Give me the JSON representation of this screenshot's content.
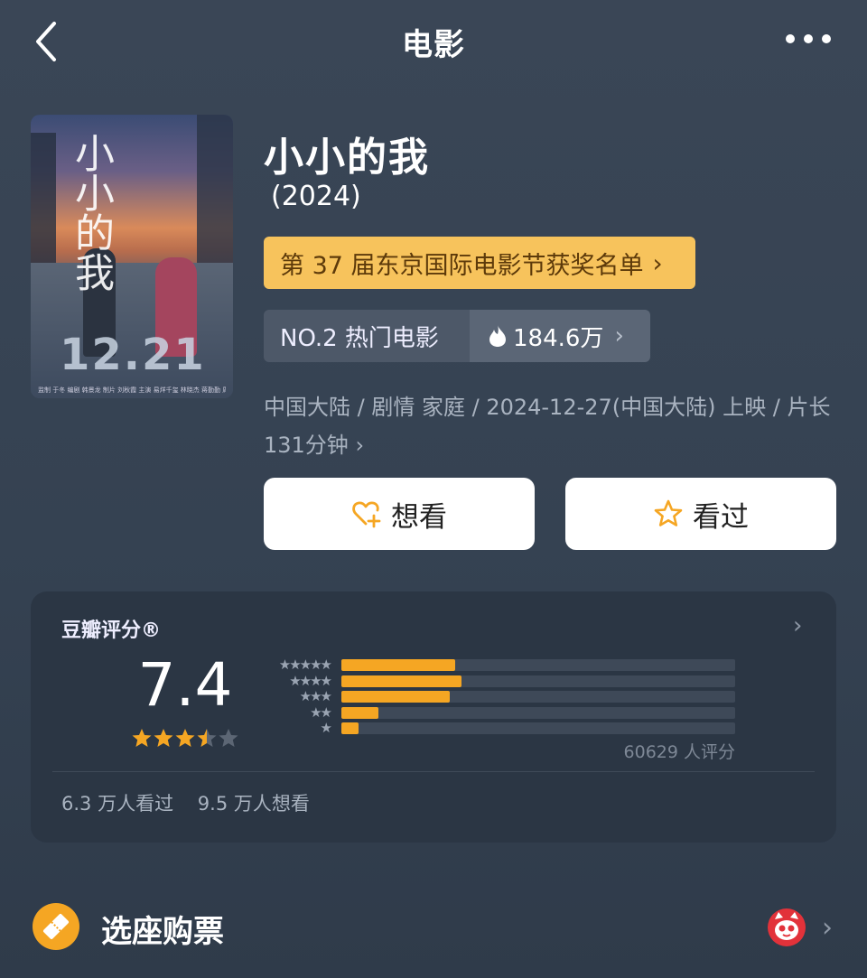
{
  "header": {
    "title": "电影"
  },
  "poster": {
    "title": "小小的我",
    "date": "12.21",
    "credit_line": "监制 于冬 编剧 韩景龙 制片 刘秋霞 主演 易烊千玺 林晓杰 蒋勤勤 周雨彤"
  },
  "movie": {
    "title": "小小的我",
    "year": "(2024)",
    "award_banner": "第 37 届东京国际电影节获奖名单",
    "rank_label": "NO.2 热门电影",
    "heat": "184.6万",
    "meta_line1": "中国大陆 / 剧情 家庭 / 2024-12-27(中国大陆) 上映 / 片长",
    "meta_line2": "131分钟"
  },
  "actions": {
    "want_label": "想看",
    "seen_label": "看过"
  },
  "rating": {
    "label": "豆瓣评分®",
    "score": "7.4",
    "star_rating": 3.5,
    "distribution": [
      {
        "stars": "★★★★★",
        "fraction": 0.288
      },
      {
        "stars": "★★★★",
        "fraction": 0.306
      },
      {
        "stars": "★★★",
        "fraction": 0.275
      },
      {
        "stars": "★★",
        "fraction": 0.094
      },
      {
        "stars": "★",
        "fraction": 0.044
      }
    ],
    "count": "60629 人评分",
    "seen_count": "6.3 万人看过",
    "want_count": "9.5 万人想看"
  },
  "ticket": {
    "label": "选座购票"
  },
  "colors": {
    "accent": "#f5a623",
    "award_bg": "#f7c35c",
    "card_bg": "#2b3644"
  }
}
